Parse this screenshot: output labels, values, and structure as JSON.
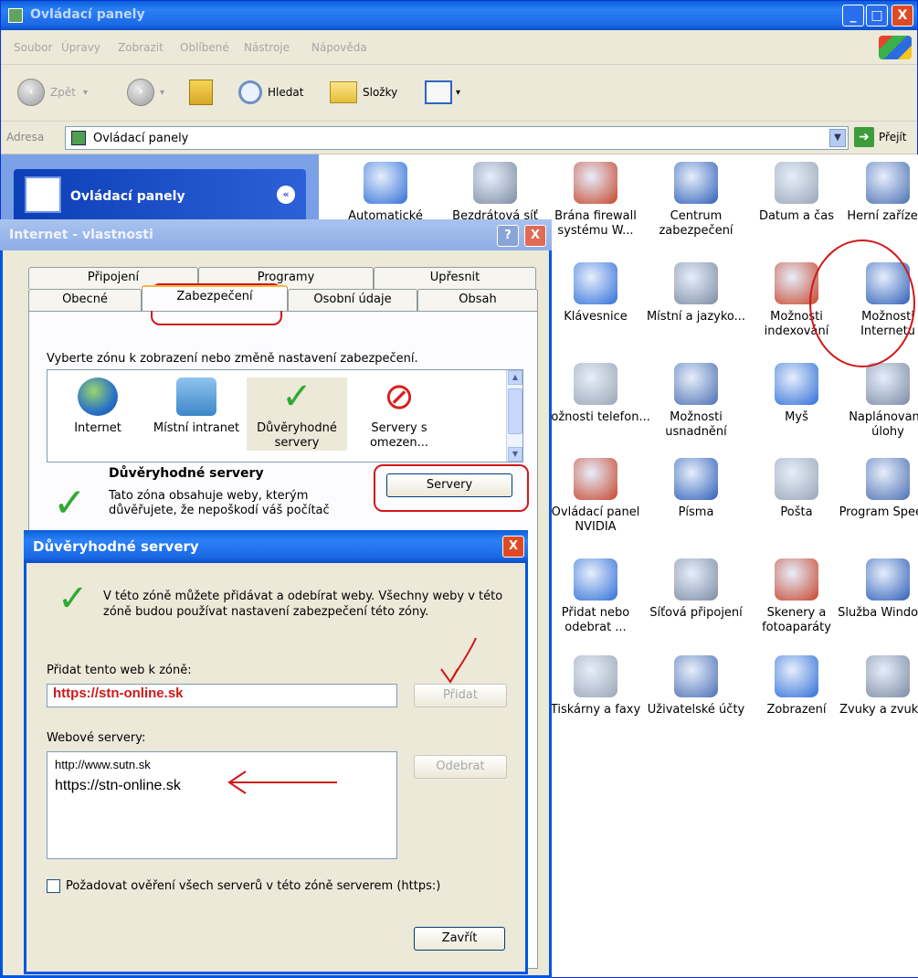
{
  "window": {
    "title": "Ovládací panely",
    "buttons": {
      "minimize": "_",
      "maximize": "□",
      "close": "X"
    }
  },
  "menu": [
    "Soubor",
    "Úpravy",
    "Zobrazit",
    "Oblíbené",
    "Nástroje",
    "Nápověda"
  ],
  "toolbar": {
    "back": "Zpět",
    "search": "Hledat",
    "folders": "Složky"
  },
  "address": {
    "label": "Adresa",
    "value": "Ovládací panely",
    "go": "Přejít"
  },
  "taskpane": {
    "title": "Ovládací panely",
    "collapse": "«"
  },
  "control_panel_items": [
    {
      "label": "Automatické"
    },
    {
      "label": "Bezdrátová síť"
    },
    {
      "label": "Brána firewall systému W..."
    },
    {
      "label": "Centrum zabezpečení"
    },
    {
      "label": "Datum a čas"
    },
    {
      "label": "Herní zařízení"
    },
    {
      "label": "Klávesnice"
    },
    {
      "label": "Místní a jazyko..."
    },
    {
      "label": "Možnosti indexování"
    },
    {
      "label": "Možnosti Internetu"
    },
    {
      "label": "Možnosti telefon..."
    },
    {
      "label": "Možnosti usnadnění"
    },
    {
      "label": "Myš"
    },
    {
      "label": "Naplánované úlohy"
    },
    {
      "label": "Ovládací panel NVIDIA"
    },
    {
      "label": "Písma"
    },
    {
      "label": "Pošta"
    },
    {
      "label": "Program Speech"
    },
    {
      "label": "Přidat nebo odebrat ..."
    },
    {
      "label": "Síťová připojení"
    },
    {
      "label": "Skenery a fotoaparáty"
    },
    {
      "label": "Služba Window..."
    },
    {
      "label": "Tiskárny a faxy"
    },
    {
      "label": "Uživatelské účty"
    },
    {
      "label": "Zobrazení"
    },
    {
      "label": "Zvuky a zvuko..."
    }
  ],
  "inet": {
    "title": "Internet - vlastnosti",
    "help": "?",
    "close": "X",
    "tabs_row1": [
      "Připojení",
      "Programy",
      "Upřesnit"
    ],
    "tabs_row2": [
      "Obecné",
      "Zabezpečení",
      "Osobní údaje",
      "Obsah"
    ],
    "zone_prompt": "Vyberte zónu k zobrazení nebo změně nastavení zabezpečení.",
    "zones": [
      {
        "label": "Internet"
      },
      {
        "label": "Místní intranet"
      },
      {
        "label": "Důvěryhodné servery"
      },
      {
        "label": "Servery s omezen..."
      }
    ],
    "trusted_title": "Důvěryhodné servery",
    "trusted_desc": "Tato zóna obsahuje weby, kterým důvěřujete, že nepoškodí váš počítač",
    "servers_button": "Servery"
  },
  "trusted_dialog": {
    "title": "Důvěryhodné servery",
    "close": "X",
    "info": "V této zóně můžete přidávat a odebírat weby. Všechny weby v této zóně budou používat nastavení zabezpečení této zóny.",
    "add_label": "Přidat tento web k zóně:",
    "add_value": "https://stn-online.sk",
    "add_button": "Přidat",
    "websites_label": "Webové servery:",
    "websites": [
      "http://www.sutn.sk",
      "https://stn-online.sk"
    ],
    "remove_button": "Odebrat",
    "require_https": "Požadovat ověření všech serverů v této zóně serverem (https:)",
    "close_button": "Zavřít"
  },
  "colors": {
    "xp_blue": "#0054e3",
    "annotation_red": "#d01818",
    "check_green": "#31a931"
  }
}
